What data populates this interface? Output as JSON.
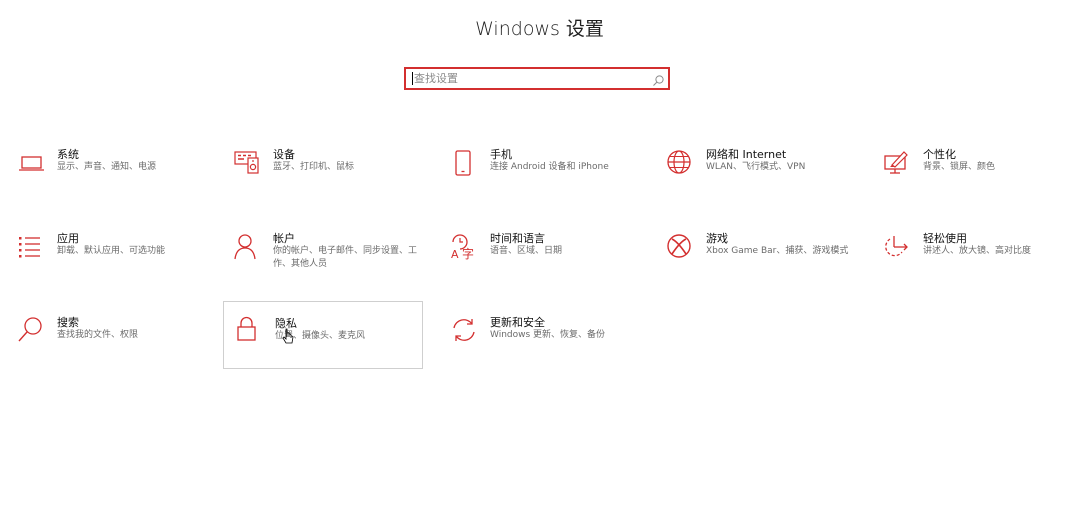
{
  "window": {
    "title": "Windows 设置"
  },
  "search": {
    "placeholder": "查找设置",
    "value": ""
  },
  "accent": "#d32f2f",
  "tiles": [
    {
      "title": "系统",
      "desc": "显示、声音、通知、电源",
      "icon": "laptop-icon"
    },
    {
      "title": "设备",
      "desc": "蓝牙、打印机、鼠标",
      "icon": "devices-icon"
    },
    {
      "title": "手机",
      "desc": "连接 Android 设备和 iPhone",
      "icon": "phone-icon"
    },
    {
      "title": "网络和 Internet",
      "desc": "WLAN、飞行模式、VPN",
      "icon": "globe-icon"
    },
    {
      "title": "个性化",
      "desc": "背景、锁屏、颜色",
      "icon": "personalization-icon"
    },
    {
      "title": "应用",
      "desc": "卸载、默认应用、可选功能",
      "icon": "apps-list-icon"
    },
    {
      "title": "帐户",
      "desc": "你的帐户、电子邮件、同步设置、工作、其他人员",
      "icon": "person-icon"
    },
    {
      "title": "时间和语言",
      "desc": "语音、区域、日期",
      "icon": "time-language-icon"
    },
    {
      "title": "游戏",
      "desc": "Xbox Game Bar、捕获、游戏模式",
      "icon": "xbox-icon"
    },
    {
      "title": "轻松使用",
      "desc": "讲述人、放大镜、高对比度",
      "icon": "ease-of-access-icon"
    },
    {
      "title": "搜索",
      "desc": "查找我的文件、权限",
      "icon": "search-icon"
    },
    {
      "title": "隐私",
      "desc": "位置、摄像头、麦克风",
      "icon": "lock-icon"
    },
    {
      "title": "更新和安全",
      "desc": "Windows 更新、恢复、备份",
      "icon": "update-icon"
    }
  ]
}
